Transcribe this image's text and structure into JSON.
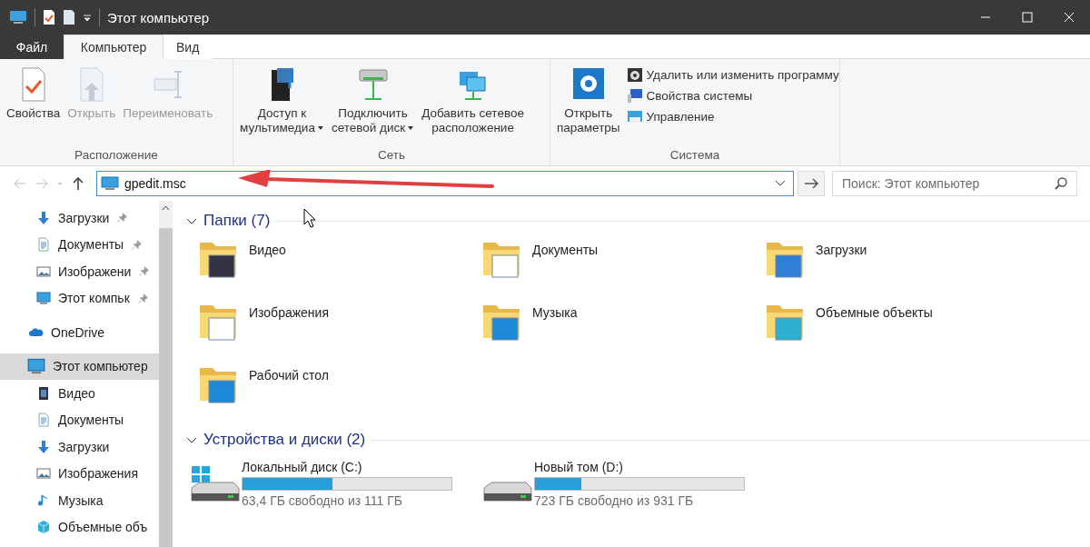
{
  "window": {
    "title": "Этот компьютер"
  },
  "ribbon_tabs": [
    {
      "label": "Файл",
      "selected": false,
      "kind": "file"
    },
    {
      "label": "Компьютер",
      "selected": true,
      "kind": "tab"
    },
    {
      "label": "Вид",
      "selected": false,
      "kind": "tab"
    }
  ],
  "ribbon_groups": [
    {
      "label": "Расположение",
      "buttons": [
        {
          "kind": "large",
          "lines": [
            "Свойства"
          ],
          "disabled": false,
          "dropdown": false
        },
        {
          "kind": "large",
          "lines": [
            "Открыть"
          ],
          "disabled": true,
          "dropdown": false
        },
        {
          "kind": "large",
          "lines": [
            "Переименовать"
          ],
          "disabled": true,
          "dropdown": false
        }
      ]
    },
    {
      "label": "Сеть",
      "buttons": [
        {
          "kind": "large",
          "lines": [
            "Доступ к",
            "мультимедиа"
          ],
          "disabled": false,
          "dropdown": true
        },
        {
          "kind": "large",
          "lines": [
            "Подключить",
            "сетевой диск"
          ],
          "disabled": false,
          "dropdown": true
        },
        {
          "kind": "large",
          "lines": [
            "Добавить сетевое",
            "расположение"
          ],
          "disabled": false,
          "dropdown": false
        }
      ]
    },
    {
      "label": "Система",
      "buttons": [
        {
          "kind": "large",
          "lines": [
            "Открыть",
            "параметры"
          ],
          "disabled": false,
          "dropdown": false
        },
        {
          "kind": "small",
          "lines": [
            "Удалить или изменить программу"
          ],
          "disabled": false
        },
        {
          "kind": "small",
          "lines": [
            "Свойства системы"
          ],
          "disabled": false
        },
        {
          "kind": "small",
          "lines": [
            "Управление"
          ],
          "disabled": false
        }
      ]
    }
  ],
  "address": {
    "value": "gpedit.msc"
  },
  "search": {
    "placeholder": "Поиск: Этот компьютер"
  },
  "sidebar": {
    "items": [
      {
        "label": "Загрузки",
        "pinned": true,
        "selected": false
      },
      {
        "label": "Документы",
        "pinned": true,
        "selected": false
      },
      {
        "label": "Изображени",
        "pinned": true,
        "selected": false
      },
      {
        "label": "Этот компьк",
        "pinned": true,
        "selected": false
      },
      {
        "label": "OneDrive",
        "pinned": false,
        "selected": false
      },
      {
        "label": "Этот компьютер",
        "pinned": false,
        "selected": true,
        "children": [
          {
            "label": "Видео",
            "selected": false
          },
          {
            "label": "Документы",
            "selected": false
          },
          {
            "label": "Загрузки",
            "selected": false
          },
          {
            "label": "Изображения",
            "selected": false
          },
          {
            "label": "Музыка",
            "selected": false
          },
          {
            "label": "Объемные объ",
            "selected": false
          }
        ]
      }
    ]
  },
  "sections": [
    {
      "kind": "folders",
      "title": "Папки (7)",
      "expanded": true,
      "items": [
        {
          "label": "Видео"
        },
        {
          "label": "Документы"
        },
        {
          "label": "Загрузки"
        },
        {
          "label": "Изображения"
        },
        {
          "label": "Музыка"
        },
        {
          "label": "Объемные объекты"
        },
        {
          "label": "Рабочий стол"
        }
      ]
    },
    {
      "kind": "drives",
      "title": "Устройства и диски (2)",
      "expanded": true,
      "items": [
        {
          "label": "Локальный диск (C:)",
          "level": 0.43,
          "free": "63,4 ГБ свободно из 111 ГБ",
          "system": true
        },
        {
          "label": "Новый том (D:)",
          "level": 0.22,
          "free": "723 ГБ свободно из 931 ГБ",
          "system": false
        }
      ]
    }
  ]
}
